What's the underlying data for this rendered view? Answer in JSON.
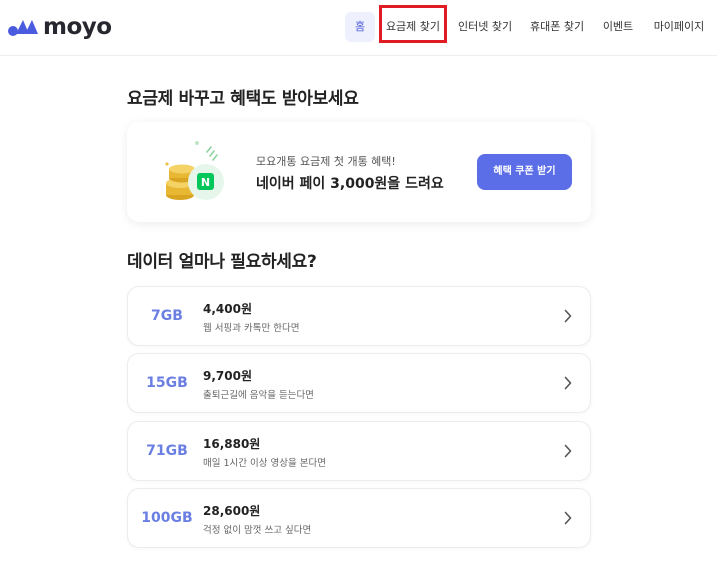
{
  "header": {
    "logo_text": "moyo",
    "nav": [
      {
        "label": "홈"
      },
      {
        "label": "요금제 찾기"
      },
      {
        "label": "인터넷 찾기"
      },
      {
        "label": "휴대폰 찾기"
      },
      {
        "label": "이벤트"
      },
      {
        "label": "마이페이지"
      }
    ]
  },
  "main": {
    "section1_title": "요금제 바꾸고 혜택도 받아보세요",
    "promo": {
      "subtitle": "모요개통 요금제 첫 개통 혜택!",
      "title": "네이버 페이 3,000원을 드려요",
      "button_label": "혜택 쿠폰 받기",
      "badge_letter": "N"
    },
    "section2_title": "데이터 얼마나 필요하세요?",
    "plans": [
      {
        "gb": "7GB",
        "price": "4,400원",
        "desc": "웹 서핑과 카톡만 한다면"
      },
      {
        "gb": "15GB",
        "price": "9,700원",
        "desc": "출퇴근길에 음악을 듣는다면"
      },
      {
        "gb": "71GB",
        "price": "16,880원",
        "desc": "매일 1시간 이상 영상을 본다면"
      },
      {
        "gb": "100GB",
        "price": "28,600원",
        "desc": "걱정 없이 맘껏 쓰고 싶다면"
      }
    ]
  },
  "colors": {
    "brand": "#5b6ee8",
    "gb_text": "#6b7fe3",
    "highlight_box": "#e01b24",
    "naver_green": "#03c75a"
  }
}
